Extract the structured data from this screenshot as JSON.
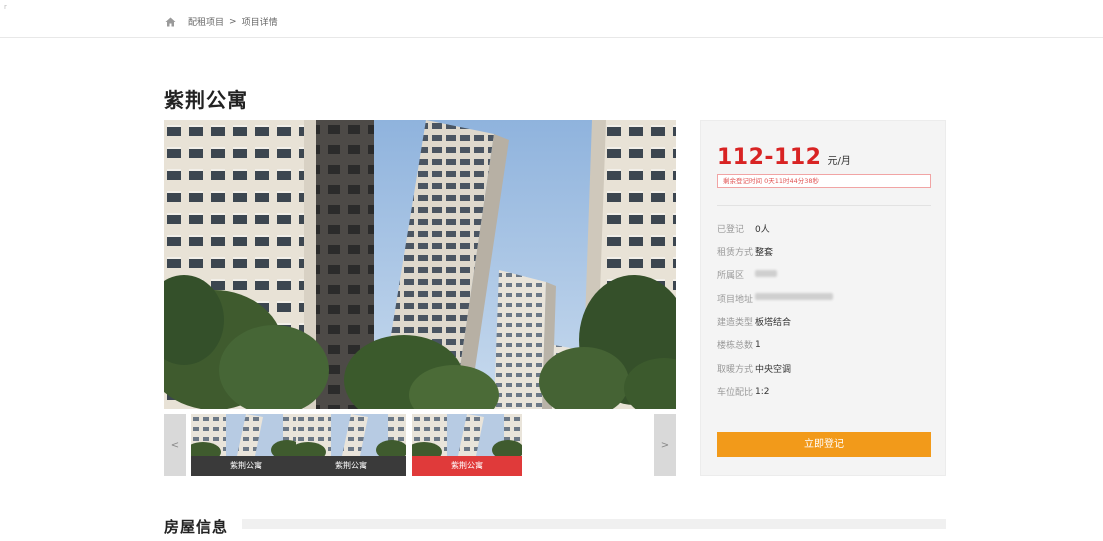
{
  "breadcrumb": {
    "items": [
      "配租项目",
      "项目详情"
    ],
    "separator": ">"
  },
  "title": "紫荆公寓",
  "gallery": {
    "prev_label": "<",
    "next_label": ">",
    "thumbnails": [
      {
        "label": "紫荆公寓",
        "active": false
      },
      {
        "label": "紫荆公寓",
        "active": false
      },
      {
        "label": "紫荆公寓",
        "active": true
      }
    ]
  },
  "info": {
    "price": "112-112",
    "price_unit": "元/月",
    "countdown": "剩余登记时间 0天11时44分38秒",
    "attributes": [
      {
        "label": "已登记",
        "value": "0人"
      },
      {
        "label": "租赁方式",
        "value": "整套"
      },
      {
        "label": "所属区",
        "value": ""
      },
      {
        "label": "项目地址",
        "value": ""
      },
      {
        "label": "建造类型",
        "value": "板塔结合"
      },
      {
        "label": "楼栋总数",
        "value": "1"
      },
      {
        "label": "取暖方式",
        "value": "中央空调"
      },
      {
        "label": "车位配比",
        "value": "1:2"
      }
    ],
    "register_button": "立即登记"
  },
  "section": {
    "title": "房屋信息"
  },
  "colors": {
    "price": "#d82323",
    "register_button": "#f29a1a",
    "active_thumb": "#e03a3a"
  }
}
